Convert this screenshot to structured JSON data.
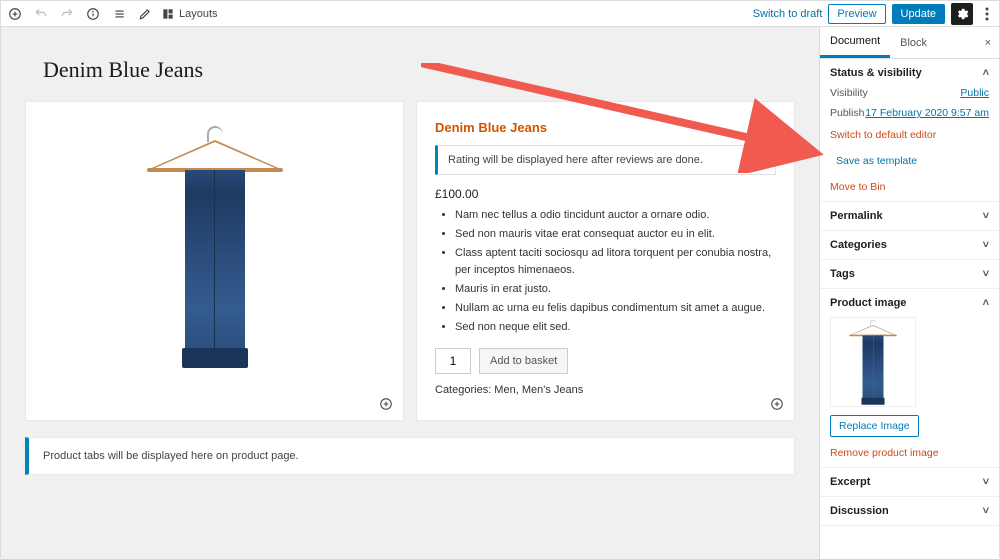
{
  "toolbar": {
    "layouts_label": "Layouts",
    "switch_draft": "Switch to draft",
    "preview": "Preview",
    "update": "Update"
  },
  "page": {
    "title": "Denim Blue Jeans"
  },
  "product": {
    "title": "Denim Blue Jeans",
    "rating_notice": "Rating will be displayed here after reviews are done.",
    "price": "£100.00",
    "bullets": [
      "Nam nec tellus a odio tincidunt auctor a ornare odio.",
      "Sed non mauris vitae erat consequat auctor eu in elit.",
      "Class aptent taciti sociosqu ad litora torquent per conubia nostra, per inceptos himenaeos.",
      "Mauris in erat justo.",
      "Nullam ac urna eu felis dapibus condimentum sit amet a augue.",
      "Sed non neque elit sed."
    ],
    "qty": "1",
    "add_to_basket": "Add to basket",
    "categories_label": "Categories: Men, Men's Jeans"
  },
  "tabs_notice": "Product tabs will be displayed here on product page.",
  "sidebar": {
    "tabs": {
      "document": "Document",
      "block": "Block"
    },
    "status": {
      "title": "Status & visibility",
      "visibility_k": "Visibility",
      "visibility_v": "Public",
      "publish_k": "Publish",
      "publish_v": "17 February 2020 9:57 am",
      "switch_editor": "Switch to default editor",
      "save_template": "Save as template",
      "move_bin": "Move to Bin"
    },
    "permalink": "Permalink",
    "categories": "Categories",
    "tags": "Tags",
    "product_image": {
      "title": "Product image",
      "replace": "Replace Image",
      "remove": "Remove product image"
    },
    "excerpt": "Excerpt",
    "discussion": "Discussion"
  }
}
